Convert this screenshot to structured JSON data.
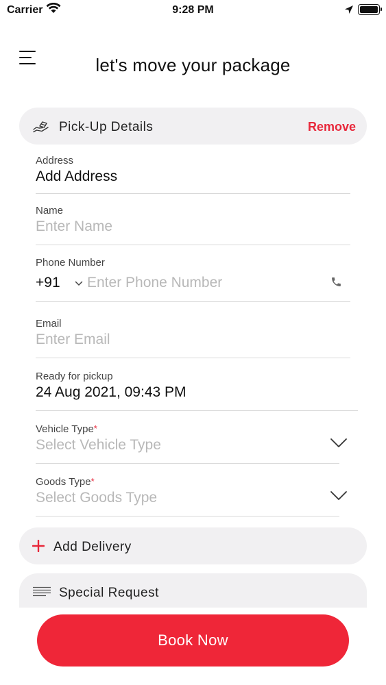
{
  "status_bar": {
    "carrier": "Carrier",
    "time": "9:28 PM"
  },
  "header": {
    "title": "let's move your package"
  },
  "pickup": {
    "title": "Pick-Up Details",
    "remove_label": "Remove",
    "fields": {
      "address": {
        "label": "Address",
        "value": "Add Address"
      },
      "name": {
        "label": "Name",
        "placeholder": "Enter Name"
      },
      "phone": {
        "label": "Phone Number",
        "country_code": "+91",
        "placeholder": "Enter Phone Number"
      },
      "email": {
        "label": "Email",
        "placeholder": "Enter Email"
      },
      "ready": {
        "label": "Ready for pickup",
        "value": "24 Aug 2021, 09:43 PM"
      },
      "vehicle": {
        "label": "Vehicle Type",
        "required": "*",
        "placeholder": "Select Vehicle Type"
      },
      "goods": {
        "label": "Goods Type",
        "required": "*",
        "placeholder": "Select Goods Type"
      }
    }
  },
  "delivery": {
    "title": "Add Delivery"
  },
  "special": {
    "title": "Special Request"
  },
  "book_button": {
    "label": "Book Now"
  },
  "colors": {
    "accent": "#ef2638",
    "remove": "#e8283b",
    "section_bg": "#f1f0f2",
    "placeholder": "#b8b8b8"
  },
  "icons": {
    "menu": "hamburger-menu-icon",
    "pickup": "hand-package-icon",
    "add": "plus-icon",
    "special": "lines-text-icon",
    "phone": "phone-icon",
    "dropdown": "chevron-down-icon"
  }
}
